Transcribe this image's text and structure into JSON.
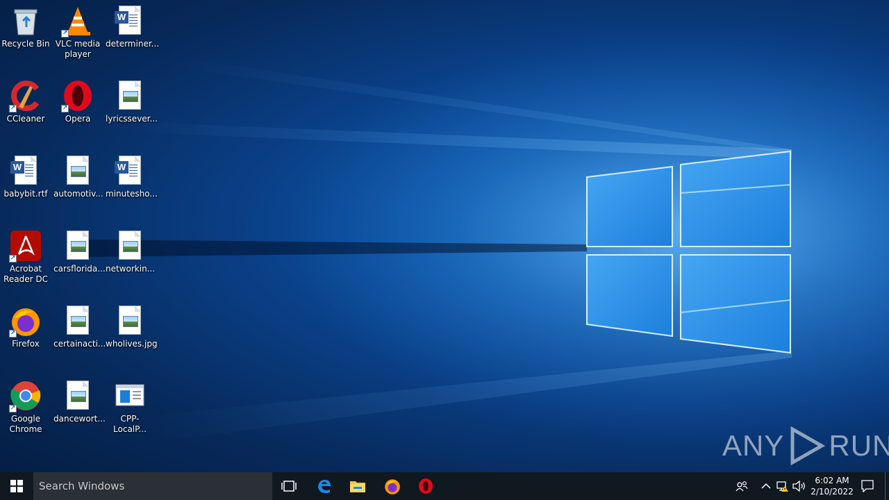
{
  "desktop": {
    "icons": [
      {
        "label": "Recycle Bin",
        "icon": "recycle-bin-icon"
      },
      {
        "label": "VLC media player",
        "icon": "vlc-icon"
      },
      {
        "label": "determiner...",
        "icon": "word-document-icon"
      },
      {
        "label": "CCleaner",
        "icon": "ccleaner-icon"
      },
      {
        "label": "Opera",
        "icon": "opera-icon"
      },
      {
        "label": "lyricssever...",
        "icon": "image-file-icon"
      },
      {
        "label": "babybit.rtf",
        "icon": "word-document-icon"
      },
      {
        "label": "automotiv...",
        "icon": "image-file-icon"
      },
      {
        "label": "minutesho...",
        "icon": "word-document-icon"
      },
      {
        "label": "Acrobat Reader DC",
        "icon": "acrobat-icon"
      },
      {
        "label": "carsflorida...",
        "icon": "image-file-icon"
      },
      {
        "label": "networkin...",
        "icon": "image-file-icon"
      },
      {
        "label": "Firefox",
        "icon": "firefox-icon"
      },
      {
        "label": "certainacti...",
        "icon": "image-file-icon"
      },
      {
        "label": "wholives.jpg",
        "icon": "image-file-icon"
      },
      {
        "label": "Google Chrome",
        "icon": "chrome-icon"
      },
      {
        "label": "dancewort...",
        "icon": "image-file-icon"
      },
      {
        "label": "CPP-LocalP...",
        "icon": "app-window-icon"
      }
    ]
  },
  "taskbar": {
    "search_placeholder": "Search Windows",
    "pinned": [
      "task-view-icon",
      "edge-icon",
      "file-explorer-icon",
      "firefox-icon",
      "opera-icon"
    ],
    "clock_time": "6:02 AM",
    "clock_date": "2/10/2022"
  },
  "watermark": {
    "left": "ANY",
    "right": "RUN"
  },
  "colors": {
    "taskbar": "#101820",
    "search_box": "#2b2f36",
    "accent": "#0078d7"
  }
}
